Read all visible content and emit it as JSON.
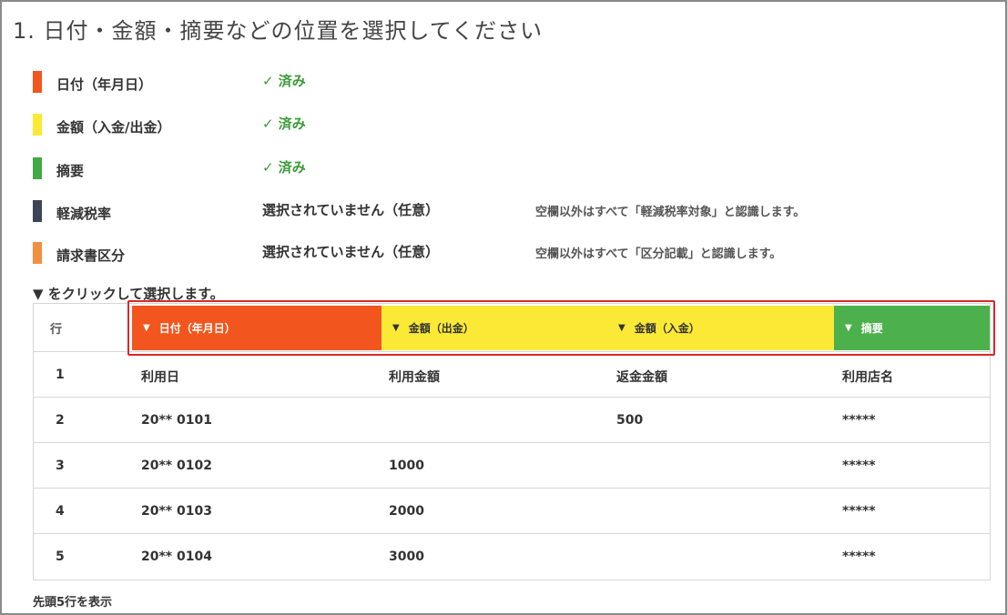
{
  "title": "1. 日付・金額・摘要などの位置を選択してください",
  "legend": [
    {
      "label": "日付（年月日）",
      "status": "✓ 済み",
      "done": true,
      "note": "",
      "color": "#f2561e"
    },
    {
      "label": "金額（入金/出金）",
      "status": "✓ 済み",
      "done": true,
      "note": "",
      "color": "#fbe936"
    },
    {
      "label": "摘要",
      "status": "✓ 済み",
      "done": true,
      "note": "",
      "color": "#43a843"
    },
    {
      "label": "軽減税率",
      "status": "選択されていません（任意）",
      "done": false,
      "note": "空欄以外はすべて「軽減税率対象」と認識します。",
      "color": "#3d4556"
    },
    {
      "label": "請求書区分",
      "status": "選択されていません（任意）",
      "done": false,
      "note": "空欄以外はすべて「区分記載」と認識します。",
      "color": "#f29040"
    }
  ],
  "instruction": "▼ をクリックして選択します。",
  "table": {
    "row_header": "行",
    "column_selectors": [
      {
        "label": "日付（年月日）",
        "bg": "#f2561e",
        "fg": "#ffffff"
      },
      {
        "label": "金額（出金）",
        "bg": "#fbe936",
        "fg": "#333333"
      },
      {
        "label": "金額（入金）",
        "bg": "#fbe936",
        "fg": "#333333"
      },
      {
        "label": "摘要",
        "bg": "#4cb04c",
        "fg": "#ffffff"
      }
    ],
    "rows": [
      [
        "1",
        "利用日",
        "利用金額",
        "返金金額",
        "利用店名"
      ],
      [
        "2",
        "20** 0101",
        "",
        "500",
        "*****"
      ],
      [
        "3",
        "20** 0102",
        "1000",
        "",
        "*****"
      ],
      [
        "4",
        "20** 0103",
        "2000",
        "",
        "*****"
      ],
      [
        "5",
        "20** 0104",
        "3000",
        "",
        "*****"
      ]
    ]
  },
  "footer_note": "先頭5行を表示",
  "colors": {
    "highlight": "#d52a2a",
    "border": "#d6d6d6",
    "done": "#3a9b3a"
  }
}
